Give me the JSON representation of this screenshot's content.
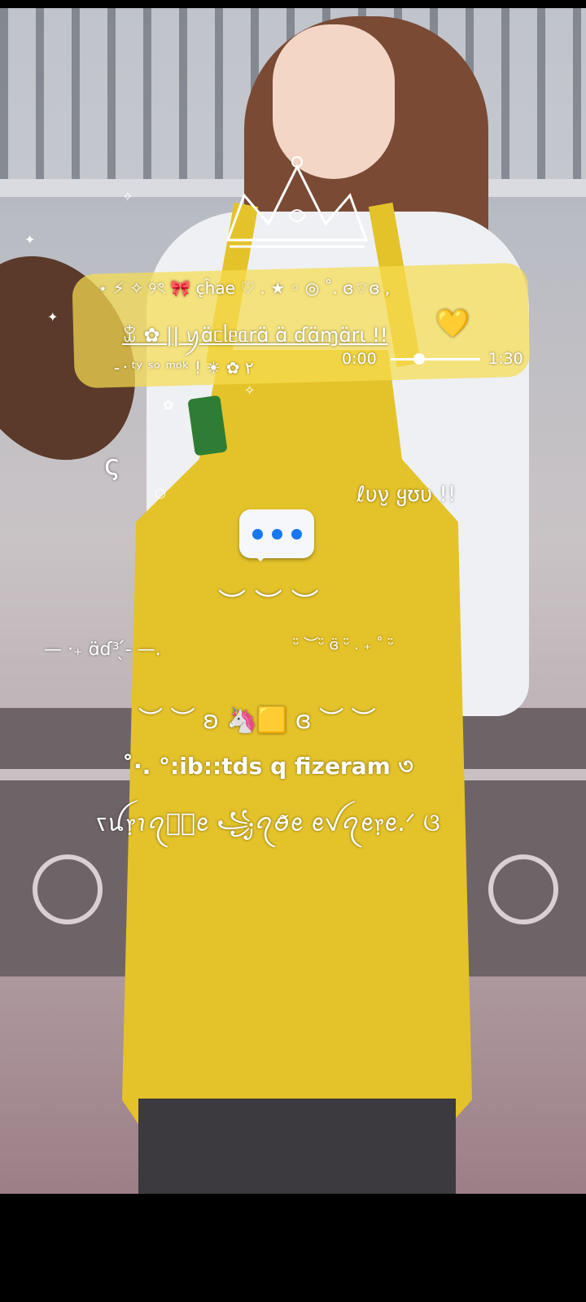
{
  "music_widget": {
    "header": "⋆ ⚡ ✧ ୨ৎ 🎀 c̨ĥae ♡ . ★ ◦ ◎ ˚. ɞ⌔ɞ ,",
    "song_title": "ꒃ ✿ || ꪗɑ̈ᥴᥣᥱᥲrɑ̈ ɑ̈ ɗɑ̈ɱɑ̈rι !! ",
    "heart_icon": "💛",
    "sub_text": "-᠂ ᵗʸ ˢᵒ ᵐᵒᵏ ! ☀ ✿ ۲",
    "time_current": "0:00",
    "time_total": "1:30",
    "progress": 0.25
  },
  "texts": {
    "luv": "ℓυν̮ ყʊυ !!",
    "small_c": "ς",
    "wave": "︶ ︶ ︶",
    "nav_left": "— ·₊ ɑ̈ɗ³ ̖́- —.",
    "nav_right": "ᵕ̈ ︶ᵕ̈ ɞ̈ ᵕ̈ . ₊ ˚ ᵕ̈",
    "deco_row": "︶ ︶ ʚ 🦄🟨 ɞ ︶ ︶",
    "line_ib": "˚·. °:ib::tds q fizeram   ৩",
    "line_script": "ꧏꪊ᥅ꪱꪖꪮ᪼ꫀ ꧁ꪖꪮ̃ꫀ ꫀꪜꪖꫀ᥅ꫀ.ᐟ ଓ"
  },
  "colors": {
    "widget": "#f6dc50",
    "apron": "#e4c22a",
    "dots": "#1877f2"
  },
  "icons": [
    "crown-icon",
    "typing-bubble-icon",
    "heart-icon",
    "unicorn-icon"
  ]
}
